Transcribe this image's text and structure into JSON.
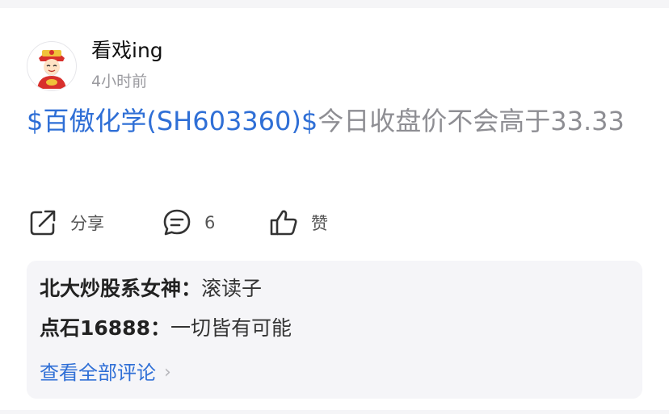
{
  "post": {
    "username": "看戏ing",
    "time": "4小时前",
    "stock_link": "$百傲化学(SH603360)$",
    "text": "今日收盘价不会高于33.33"
  },
  "actions": {
    "share_label": "分享",
    "comment_count": "6",
    "like_label": "赞"
  },
  "comments": [
    {
      "author": "北大炒股系女神：",
      "text": "滚读子"
    },
    {
      "author": "点石16888：",
      "text": "一切皆有可能"
    }
  ],
  "view_all_label": "查看全部评论",
  "colors": {
    "link": "#2f6fd6",
    "muted": "#8e8e93",
    "panel": "#f5f5f8"
  }
}
